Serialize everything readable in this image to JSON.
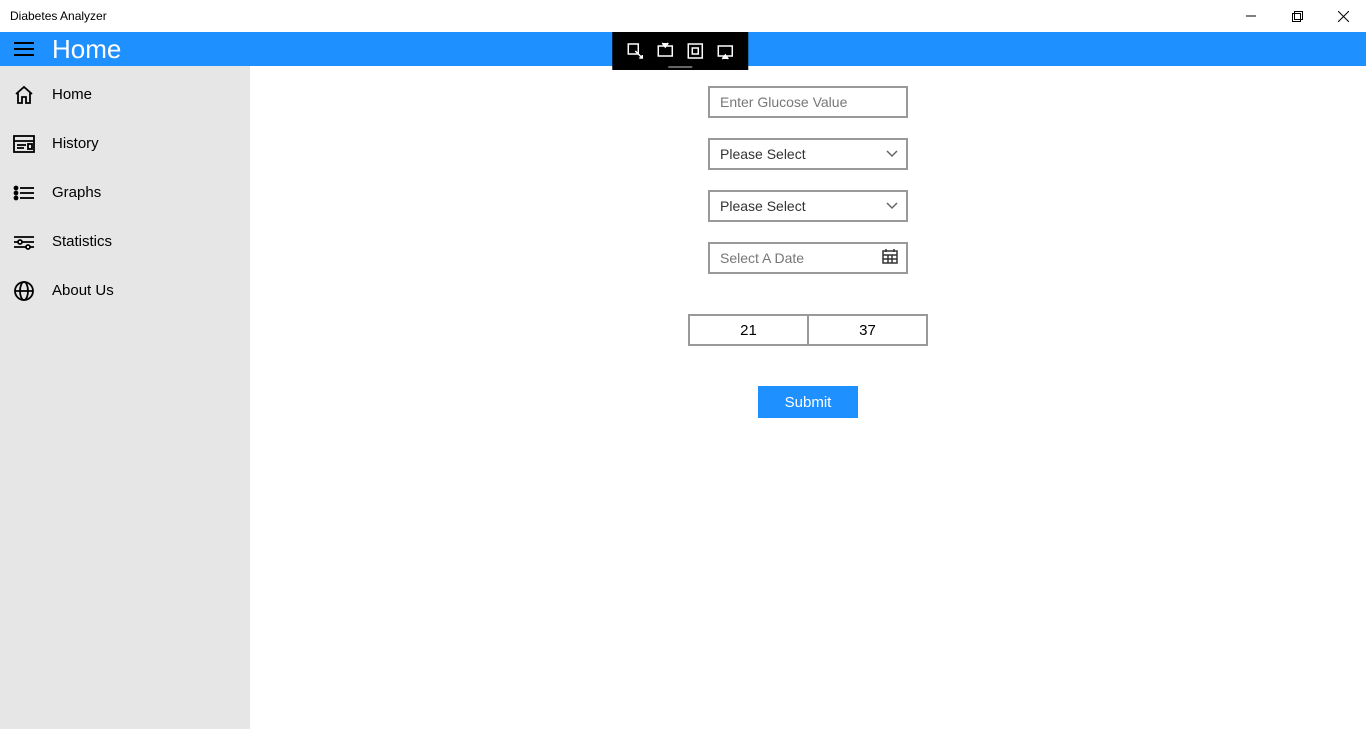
{
  "window": {
    "title": "Diabetes Analyzer"
  },
  "header": {
    "page_title": "Home"
  },
  "sidebar": {
    "items": [
      {
        "label": "Home"
      },
      {
        "label": "History"
      },
      {
        "label": "Graphs"
      },
      {
        "label": "Statistics"
      },
      {
        "label": "About Us"
      }
    ]
  },
  "form": {
    "glucose_placeholder": "Enter Glucose Value",
    "glucose_value": "",
    "select1_value": "Please Select",
    "select2_value": "Please Select",
    "date_placeholder": "Select A Date",
    "time_hour": "21",
    "time_minute": "37",
    "submit_label": "Submit"
  }
}
